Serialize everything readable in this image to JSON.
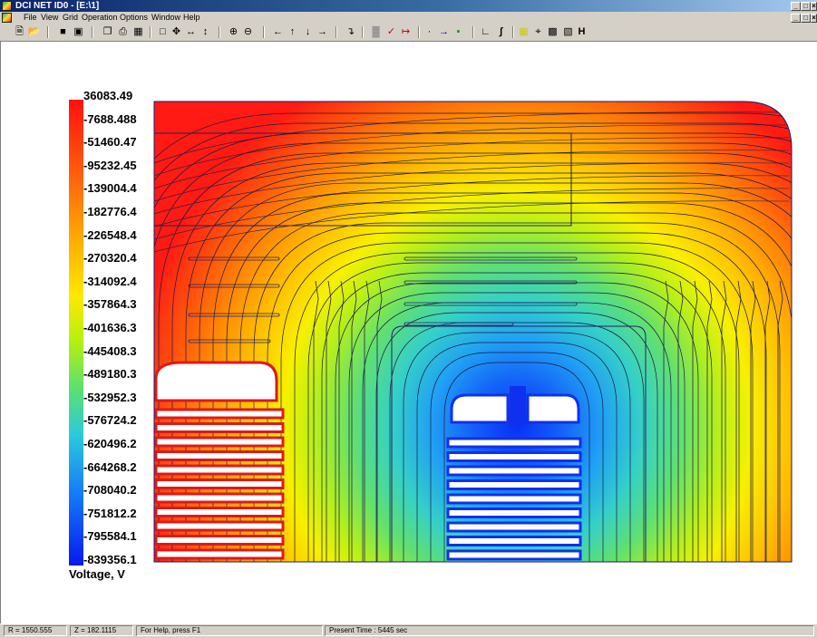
{
  "window": {
    "title": "DCI NET ID0 - [E:\\1]",
    "controls": [
      "_",
      "□",
      "×"
    ],
    "doc_controls": [
      "_",
      "□",
      "×"
    ]
  },
  "menu": [
    "File",
    "View",
    "Grid",
    "Operation",
    "Options",
    "Window",
    "Help"
  ],
  "toolbar": {
    "icons": [
      "new-icon",
      "open-icon",
      "save-icon",
      "save-all-icon",
      "copy-icon",
      "print-icon",
      "table-icon",
      "select-icon",
      "move-icon",
      "stretch-h-icon",
      "stretch-v-icon",
      "zoom-in-icon",
      "zoom-out-icon",
      "arrow-left-icon",
      "arrow-up-icon",
      "arrow-down-icon",
      "arrow-right-icon",
      "axis-icon",
      "mesh-icon",
      "probe-icon",
      "measure-icon",
      "point-icon",
      "line-icon",
      "node-icon",
      "graph-icon",
      "integral-icon",
      "grid-toggle-icon",
      "target-icon",
      "hatch-icon",
      "hatch-alt-icon",
      "h-icon"
    ]
  },
  "legend": {
    "title": "Voltage, V",
    "labels": [
      "36083.49",
      "-7688.488",
      "-51460.47",
      "-95232.45",
      "-139004.4",
      "-182776.4",
      "-226548.4",
      "-270320.4",
      "-314092.4",
      "-357864.3",
      "-401636.3",
      "-445408.3",
      "-489180.3",
      "-532952.3",
      "-576724.2",
      "-620496.2",
      "-664268.2",
      "-708040.2",
      "-751812.2",
      "-795584.1",
      "-839356.1"
    ],
    "colors": [
      "#ff1818",
      "#ff3a10",
      "#ff5a0c",
      "#ff7808",
      "#ff9406",
      "#ffae04",
      "#ffc802",
      "#ffe200",
      "#f4f000",
      "#ccf000",
      "#9cee20",
      "#6ee650",
      "#50dc80",
      "#3cd4b0",
      "#2ccadc",
      "#20b4f0",
      "#1896f4",
      "#1476f8",
      "#1058fc",
      "#0c3cfc",
      "#0820f8"
    ]
  },
  "status": {
    "r": "R = 1550.555",
    "z": "Z = 182.1115",
    "help": "For Help, press F1",
    "time": "Present Time :  5445 sec"
  }
}
